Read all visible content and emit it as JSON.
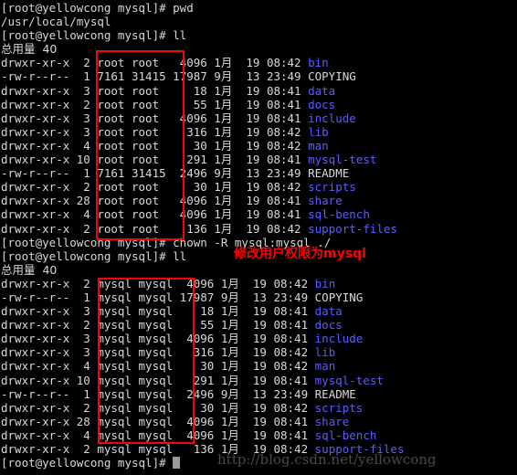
{
  "terminal": {
    "prompt": "[root@yellowcong mysql]# ",
    "total_label": "总用量  40",
    "cursor": "block-cursor"
  },
  "commands": {
    "pwd": "pwd",
    "pwd_output": "/usr/local/mysql",
    "ll_first": "ll",
    "chown": "chown -R mysql:mysql ./",
    "ll_second": "ll"
  },
  "listing_root": {
    "total": "总用量  40",
    "entries": [
      {
        "perms": "drwxr-xr-x",
        "links": "2",
        "owner": "root",
        "group": "root",
        "size": "4096",
        "month": "1月",
        "day": "19",
        "time": "08:42",
        "name": "bin",
        "type": "dir"
      },
      {
        "perms": "-rw-r--r--",
        "links": "1",
        "owner": "7161",
        "group": "31415",
        "size": "17987",
        "month": "9月",
        "day": "13",
        "time": "23:49",
        "name": "COPYING",
        "type": "file"
      },
      {
        "perms": "drwxr-xr-x",
        "links": "3",
        "owner": "root",
        "group": "root",
        "size": "18",
        "month": "1月",
        "day": "19",
        "time": "08:41",
        "name": "data",
        "type": "dir"
      },
      {
        "perms": "drwxr-xr-x",
        "links": "2",
        "owner": "root",
        "group": "root",
        "size": "55",
        "month": "1月",
        "day": "19",
        "time": "08:41",
        "name": "docs",
        "type": "dir"
      },
      {
        "perms": "drwxr-xr-x",
        "links": "3",
        "owner": "root",
        "group": "root",
        "size": "4096",
        "month": "1月",
        "day": "19",
        "time": "08:41",
        "name": "include",
        "type": "dir"
      },
      {
        "perms": "drwxr-xr-x",
        "links": "3",
        "owner": "root",
        "group": "root",
        "size": "316",
        "month": "1月",
        "day": "19",
        "time": "08:42",
        "name": "lib",
        "type": "dir"
      },
      {
        "perms": "drwxr-xr-x",
        "links": "4",
        "owner": "root",
        "group": "root",
        "size": "30",
        "month": "1月",
        "day": "19",
        "time": "08:42",
        "name": "man",
        "type": "dir"
      },
      {
        "perms": "drwxr-xr-x",
        "links": "10",
        "owner": "root",
        "group": "root",
        "size": "291",
        "month": "1月",
        "day": "19",
        "time": "08:41",
        "name": "mysql-test",
        "type": "dir"
      },
      {
        "perms": "-rw-r--r--",
        "links": "1",
        "owner": "7161",
        "group": "31415",
        "size": "2496",
        "month": "9月",
        "day": "13",
        "time": "23:49",
        "name": "README",
        "type": "file"
      },
      {
        "perms": "drwxr-xr-x",
        "links": "2",
        "owner": "root",
        "group": "root",
        "size": "30",
        "month": "1月",
        "day": "19",
        "time": "08:42",
        "name": "scripts",
        "type": "dir"
      },
      {
        "perms": "drwxr-xr-x",
        "links": "28",
        "owner": "root",
        "group": "root",
        "size": "4096",
        "month": "1月",
        "day": "19",
        "time": "08:41",
        "name": "share",
        "type": "dir"
      },
      {
        "perms": "drwxr-xr-x",
        "links": "4",
        "owner": "root",
        "group": "root",
        "size": "4096",
        "month": "1月",
        "day": "19",
        "time": "08:41",
        "name": "sql-bench",
        "type": "dir"
      },
      {
        "perms": "drwxr-xr-x",
        "links": "2",
        "owner": "root",
        "group": "root",
        "size": "136",
        "month": "1月",
        "day": "19",
        "time": "08:42",
        "name": "support-files",
        "type": "dir"
      }
    ]
  },
  "listing_mysql": {
    "total": "总用量  40",
    "entries": [
      {
        "perms": "drwxr-xr-x",
        "links": "2",
        "owner": "mysql",
        "group": "mysql",
        "size": "4096",
        "month": "1月",
        "day": "19",
        "time": "08:42",
        "name": "bin",
        "type": "dir"
      },
      {
        "perms": "-rw-r--r--",
        "links": "1",
        "owner": "mysql",
        "group": "mysql",
        "size": "17987",
        "month": "9月",
        "day": "13",
        "time": "23:49",
        "name": "COPYING",
        "type": "file"
      },
      {
        "perms": "drwxr-xr-x",
        "links": "3",
        "owner": "mysql",
        "group": "mysql",
        "size": "18",
        "month": "1月",
        "day": "19",
        "time": "08:41",
        "name": "data",
        "type": "dir"
      },
      {
        "perms": "drwxr-xr-x",
        "links": "2",
        "owner": "mysql",
        "group": "mysql",
        "size": "55",
        "month": "1月",
        "day": "19",
        "time": "08:41",
        "name": "docs",
        "type": "dir"
      },
      {
        "perms": "drwxr-xr-x",
        "links": "3",
        "owner": "mysql",
        "group": "mysql",
        "size": "4096",
        "month": "1月",
        "day": "19",
        "time": "08:41",
        "name": "include",
        "type": "dir"
      },
      {
        "perms": "drwxr-xr-x",
        "links": "3",
        "owner": "mysql",
        "group": "mysql",
        "size": "316",
        "month": "1月",
        "day": "19",
        "time": "08:42",
        "name": "lib",
        "type": "dir"
      },
      {
        "perms": "drwxr-xr-x",
        "links": "4",
        "owner": "mysql",
        "group": "mysql",
        "size": "30",
        "month": "1月",
        "day": "19",
        "time": "08:42",
        "name": "man",
        "type": "dir"
      },
      {
        "perms": "drwxr-xr-x",
        "links": "10",
        "owner": "mysql",
        "group": "mysql",
        "size": "291",
        "month": "1月",
        "day": "19",
        "time": "08:41",
        "name": "mysql-test",
        "type": "dir"
      },
      {
        "perms": "-rw-r--r--",
        "links": "1",
        "owner": "mysql",
        "group": "mysql",
        "size": "2496",
        "month": "9月",
        "day": "13",
        "time": "23:49",
        "name": "README",
        "type": "file"
      },
      {
        "perms": "drwxr-xr-x",
        "links": "2",
        "owner": "mysql",
        "group": "mysql",
        "size": "30",
        "month": "1月",
        "day": "19",
        "time": "08:42",
        "name": "scripts",
        "type": "dir"
      },
      {
        "perms": "drwxr-xr-x",
        "links": "28",
        "owner": "mysql",
        "group": "mysql",
        "size": "4096",
        "month": "1月",
        "day": "19",
        "time": "08:41",
        "name": "share",
        "type": "dir"
      },
      {
        "perms": "drwxr-xr-x",
        "links": "4",
        "owner": "mysql",
        "group": "mysql",
        "size": "4096",
        "month": "1月",
        "day": "19",
        "time": "08:41",
        "name": "sql-bench",
        "type": "dir"
      },
      {
        "perms": "drwxr-xr-x",
        "links": "2",
        "owner": "mysql",
        "group": "mysql",
        "size": "136",
        "month": "1月",
        "day": "19",
        "time": "08:42",
        "name": "support-files",
        "type": "dir"
      }
    ]
  },
  "annotations": {
    "chown_note": "修改用户权限为mysql",
    "color": "#ff0000",
    "box_root_owner": "owner-column-root",
    "box_mysql_owner": "owner-column-mysql"
  },
  "watermark": {
    "text": "http://blog.csdn.net/yellowcong",
    "color": "#4a4a4a"
  },
  "colors": {
    "background": "#000000",
    "foreground": "#d9d9d9",
    "directory": "#5c5cff",
    "annotation": "#ff0000"
  }
}
